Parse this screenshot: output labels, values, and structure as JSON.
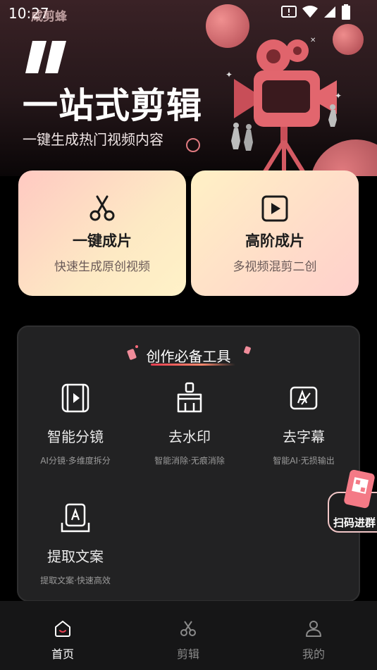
{
  "status_bar": {
    "time": "10:27",
    "app_tag": "咸剪蜂"
  },
  "hero": {
    "headline": "一站式剪辑",
    "subline": "一键生成热门视频内容"
  },
  "cards": [
    {
      "title": "一键成片",
      "subtitle": "快速生成原创视频",
      "icon": "scissors-icon"
    },
    {
      "title": "高阶成片",
      "subtitle": "多视频混剪二创",
      "icon": "play-square-icon"
    }
  ],
  "tools_section": {
    "title": "创作必备工具",
    "tools": [
      {
        "name": "智能分镜",
        "desc": "AI分镜·多维度拆分",
        "icon": "storyboard-icon"
      },
      {
        "name": "去水印",
        "desc": "智能消除·无痕消除",
        "icon": "brush-icon"
      },
      {
        "name": "去字幕",
        "desc": "智能AI·无损输出",
        "icon": "subtitle-remove-icon"
      },
      {
        "name": "提取文案",
        "desc": "提取文案·快速高效",
        "icon": "text-extract-icon"
      }
    ]
  },
  "floating_badge": {
    "label": "扫码进群",
    "icon": "qr-phone-icon"
  },
  "tab_bar": {
    "tabs": [
      {
        "label": "首页",
        "icon": "home-icon",
        "active": true
      },
      {
        "label": "剪辑",
        "icon": "scissors-icon",
        "active": false
      },
      {
        "label": "我的",
        "icon": "user-icon",
        "active": false
      }
    ]
  },
  "colors": {
    "accent": "#e33d4f",
    "background": "#000000",
    "panel": "#222223"
  }
}
